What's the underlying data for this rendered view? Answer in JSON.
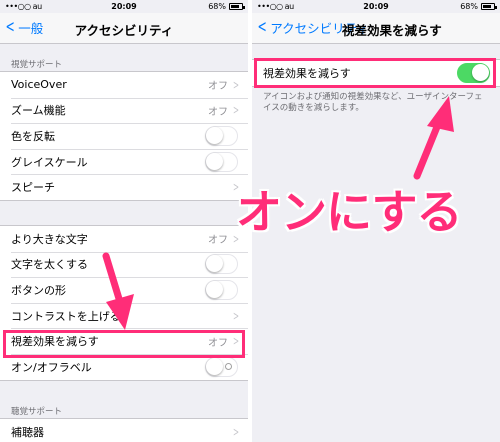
{
  "left": {
    "status": {
      "carrier": "•••○○ au",
      "time": "20:09",
      "battery": "68%"
    },
    "nav": {
      "back_label": "一般",
      "title": "アクセシビリティ"
    },
    "sections": [
      {
        "header": "視覚サポート",
        "rows": [
          {
            "label": "VoiceOver",
            "value": "オフ",
            "control": "chevron"
          },
          {
            "label": "ズーム機能",
            "value": "オフ",
            "control": "chevron"
          },
          {
            "label": "色を反転",
            "control": "toggle",
            "on": false
          },
          {
            "label": "グレイスケール",
            "control": "toggle",
            "on": false
          },
          {
            "label": "スピーチ",
            "control": "chevron"
          }
        ]
      },
      {
        "rows": [
          {
            "label": "より大きな文字",
            "value": "オフ",
            "control": "chevron"
          },
          {
            "label": "文字を太くする",
            "control": "toggle",
            "on": false
          },
          {
            "label": "ボタンの形",
            "control": "toggle",
            "on": false
          },
          {
            "label": "コントラストを上げる",
            "control": "chevron"
          },
          {
            "label": "視差効果を減らす",
            "value": "オフ",
            "control": "chevron"
          },
          {
            "label": "オン/オフラベル",
            "control": "toggle",
            "on": false
          }
        ]
      },
      {
        "header": "聴覚サポート",
        "rows": [
          {
            "label": "補聴器",
            "control": "chevron"
          }
        ]
      }
    ]
  },
  "right": {
    "status": {
      "carrier": "•••○○ au",
      "time": "20:09",
      "battery": "68%"
    },
    "nav": {
      "back_label": "アクセシビリティ",
      "title": "視差効果を減らす"
    },
    "setting": {
      "label": "視差効果を減らす",
      "on": true
    },
    "description": "アイコンおよび通知の視差効果など、ユーザインターフェイスの動きを減らします。"
  },
  "annotation": {
    "text": "オンにする",
    "color": "#ff2d78"
  },
  "colors": {
    "accent": "#007aff",
    "toggle_on": "#4cd964",
    "highlight": "#ff2d78"
  }
}
